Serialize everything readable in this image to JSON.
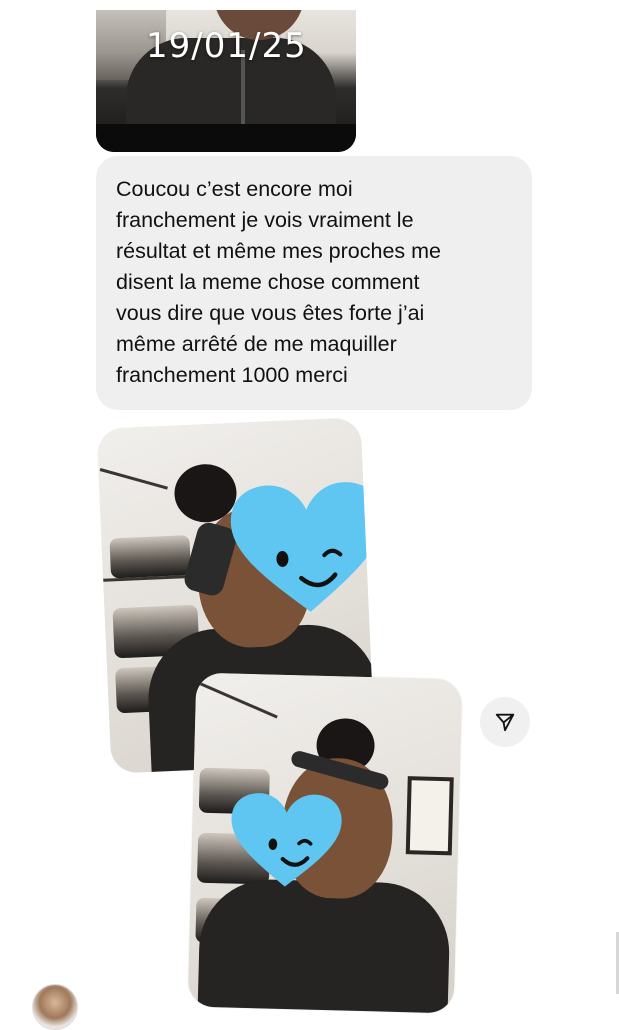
{
  "messages": {
    "top_photo": {
      "date_overlay": "19/01/25"
    },
    "text_bubble": {
      "text": "Coucou c’est encore moi\nfranchement je vois vraiment le\nrésultat et même mes proches me\ndisent la meme chose comment\nvous dire que vous êtes forte j’ai\nmême arrêté de me maquiller\nfranchement 1000 merci"
    }
  },
  "actions": {
    "share_icon": "send-icon"
  },
  "colors": {
    "bubble_bg": "#efefef",
    "heart_sticker": "#5ec6f0"
  }
}
